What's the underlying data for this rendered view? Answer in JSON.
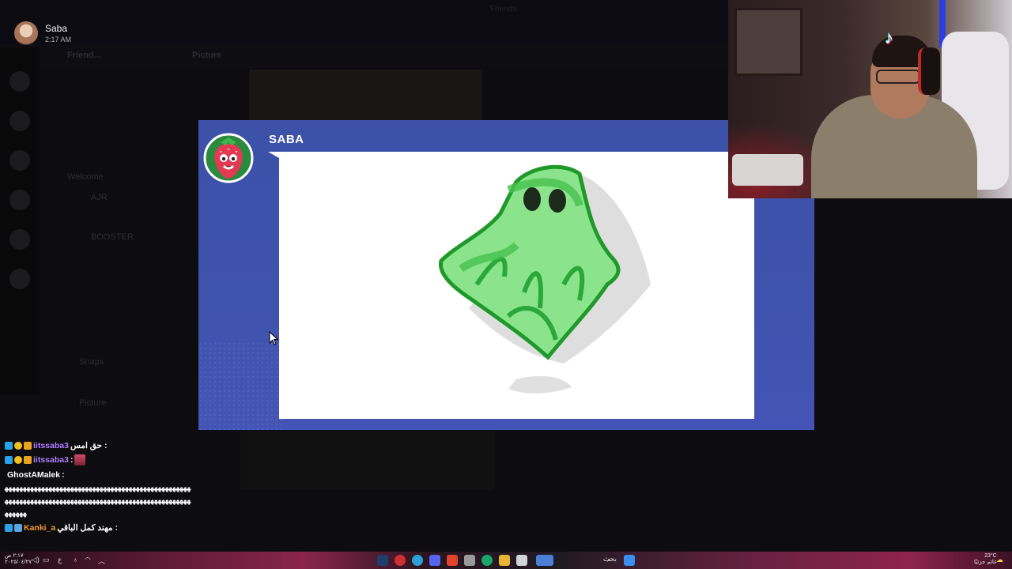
{
  "notification": {
    "user": "Saba",
    "time": "2:17 AM"
  },
  "background": {
    "title": "Friends",
    "channels": [
      "Friend...",
      "Welcome",
      "AJR",
      "BOOSTER",
      "Snaps",
      "Picture"
    ],
    "header_tab": "Picture"
  },
  "game": {
    "player_name": "SABA",
    "drawing_subject": "ghost",
    "colors": {
      "panel": "#3e53ad",
      "card": "#ffffff",
      "ghost_fill": "#7ad97a",
      "ghost_stroke": "#1f9a2a"
    }
  },
  "webcam": {
    "overlay_icon": "tiktok-icon"
  },
  "chat": {
    "messages": [
      {
        "user": "iitssaba3",
        "text": "حق امس :",
        "user_color": "#b07dff"
      },
      {
        "user": "iitssaba3",
        "text": ":",
        "user_color": "#b07dff",
        "emote": "heart-emote"
      },
      {
        "user": "GhostAMalek",
        "text": ":",
        "user_color": "#ffffff"
      },
      {
        "user": "",
        "text": "ﻬﻬﻬﻬﻬﻬﻬﻬﻬﻬﻬﻬﻬﻬﻬﻬﻬﻬﻬﻬﻬﻬﻬﻬﻬﻬﻬﻬﻬﻬﻬﻬﻬﻬﻬﻬﻬﻬﻬﻬﻬﻬﻬﻬﻬﻬﻬﻬﻬﻬﻬ"
      },
      {
        "user": "",
        "text": "ﻬﻬﻬﻬﻬﻬﻬﻬﻬﻬﻬﻬﻬﻬﻬﻬﻬﻬﻬﻬﻬﻬﻬﻬﻬﻬﻬﻬﻬﻬﻬﻬﻬﻬﻬﻬﻬﻬﻬﻬﻬﻬﻬﻬﻬﻬﻬﻬﻬﻬﻬ"
      },
      {
        "user": "",
        "text": "ﻬﻬﻬﻬﻬﻬ"
      },
      {
        "user": "Kanki_a",
        "text": "مهند كمل الباقي :",
        "user_color": "#ff9a26"
      }
    ]
  },
  "taskbar": {
    "search_label": "بحث",
    "weather_temp": "23°C",
    "weather_text": "غائم جزئيًا",
    "clock_time": "٢:١٧ ص",
    "clock_date": "٢٠٢٥/٠٤/٢٧",
    "lang": "ع"
  }
}
